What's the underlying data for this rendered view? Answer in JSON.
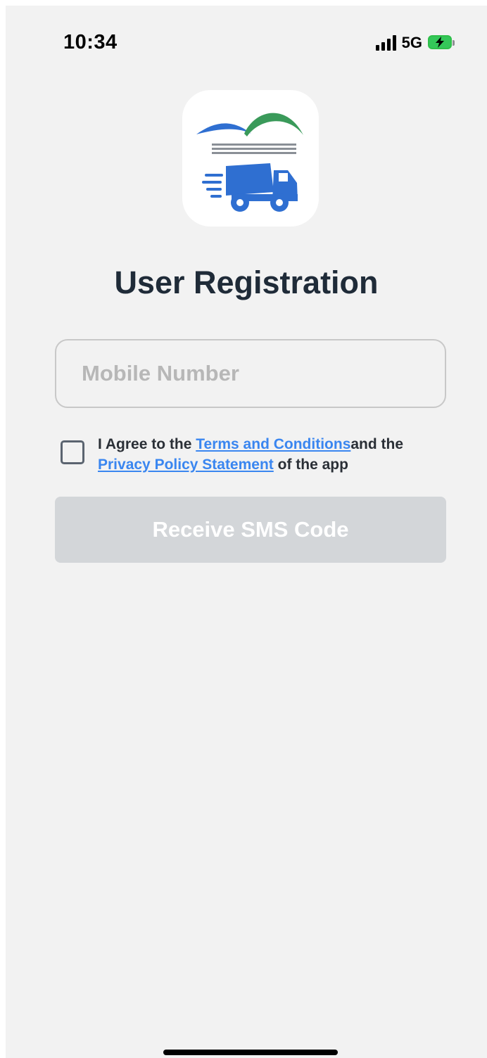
{
  "status_bar": {
    "time": "10:34",
    "network": "5G",
    "battery_icon": "battery-charging-icon",
    "signal_icon": "signal-icon"
  },
  "app": {
    "logo_icon": "delivery-truck-logo"
  },
  "title": "User Registration",
  "mobile_input": {
    "placeholder": "Mobile Number",
    "value": ""
  },
  "agreement": {
    "text_prefix": "I Agree to the ",
    "terms_link": "Terms and Conditions",
    "text_middle": "and the ",
    "privacy_link": "Privacy Policy Statement",
    "text_suffix": " of the app",
    "checked": false
  },
  "sms_button": {
    "label": "Receive SMS Code",
    "enabled": false
  },
  "colors": {
    "background": "#f2f2f2",
    "title": "#1f2b38",
    "link": "#3a86f0",
    "button_disabled": "#d3d6d9",
    "logo_blue": "#2f6fd1",
    "logo_green": "#3a9a5a"
  }
}
